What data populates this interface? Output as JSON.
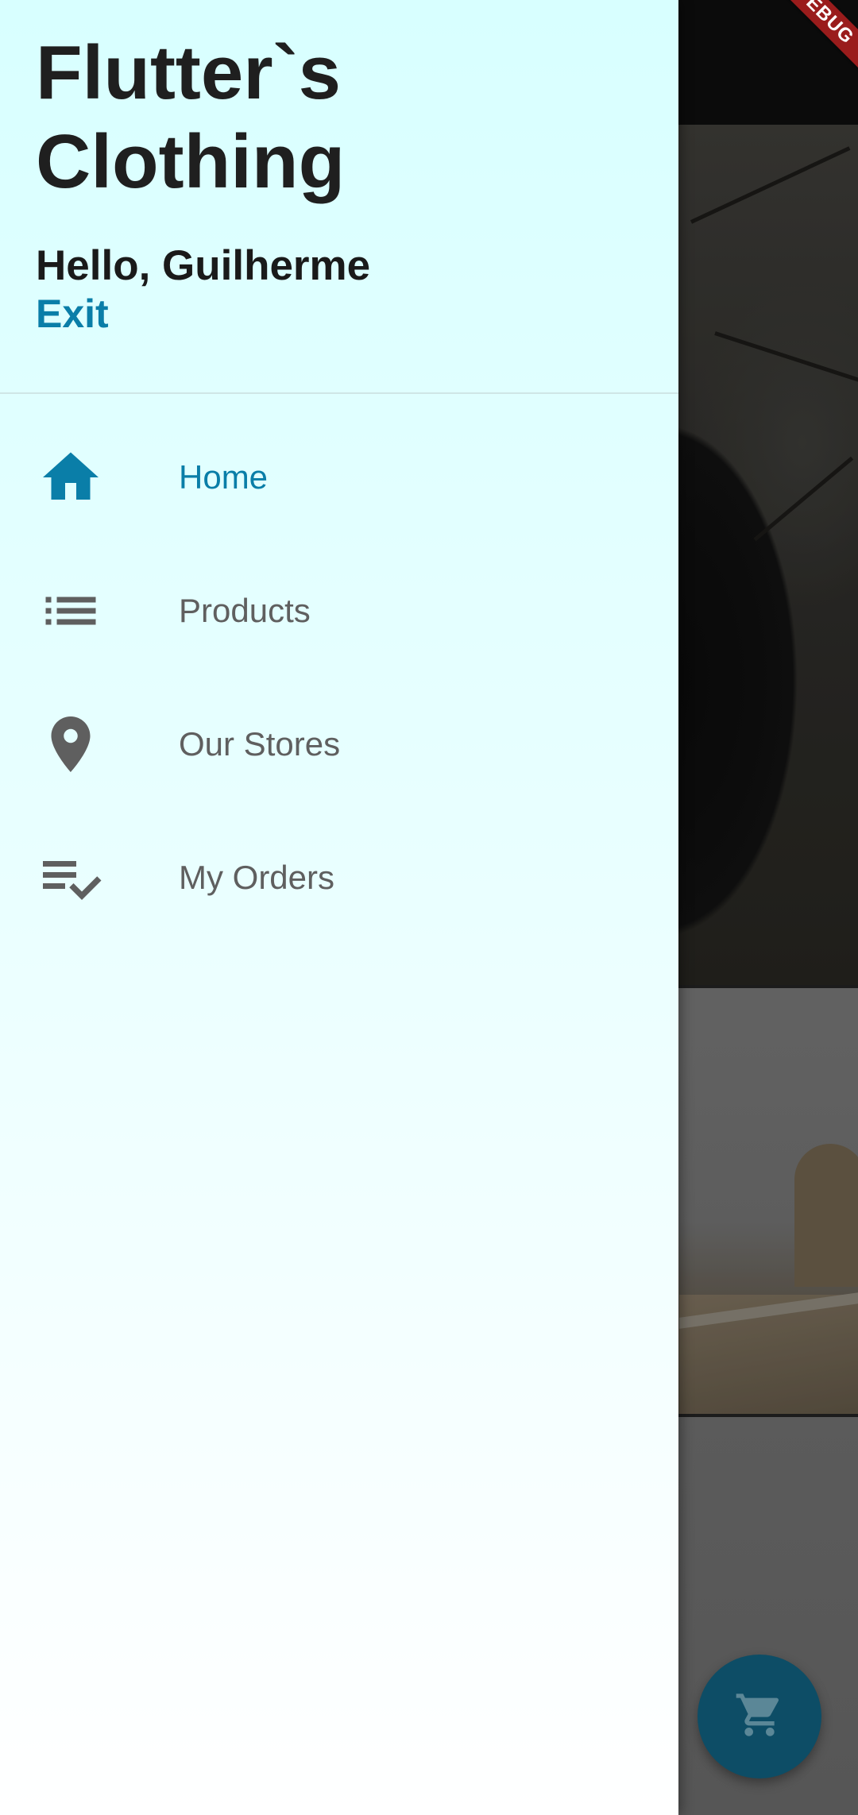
{
  "drawer": {
    "app_title": "Flutter`s\n  Clothing",
    "greeting": "Hello, Guilherme",
    "exit_label": "Exit",
    "nav_items": [
      {
        "label": "Home",
        "icon": "home-icon",
        "active": true
      },
      {
        "label": "Products",
        "icon": "list-icon",
        "active": false
      },
      {
        "label": "Our Stores",
        "icon": "location-pin-icon",
        "active": false
      },
      {
        "label": "My Orders",
        "icon": "playlist-check-icon",
        "active": false
      }
    ]
  },
  "debug_banner": {
    "label": "DEBUG"
  },
  "fab": {
    "icon": "shopping-cart-icon"
  },
  "colors": {
    "accent": "#0a7ea8",
    "inactive": "#5f5f5f",
    "fab_bg": "#0d4d66",
    "debug_red": "#9a1c1c"
  }
}
